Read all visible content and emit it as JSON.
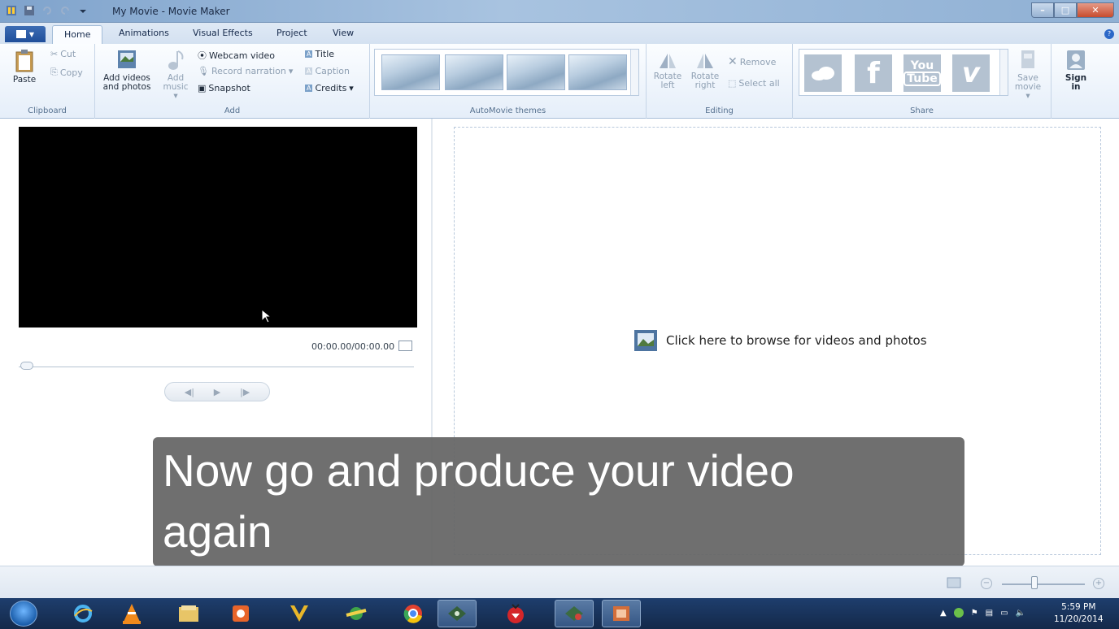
{
  "window": {
    "title": "My Movie - Movie Maker"
  },
  "tabs": [
    "Home",
    "Animations",
    "Visual Effects",
    "Project",
    "View"
  ],
  "ribbon": {
    "clipboard": {
      "paste": "Paste",
      "cut": "Cut",
      "copy": "Copy",
      "label": "Clipboard"
    },
    "add": {
      "add_videos_line1": "Add videos",
      "add_videos_line2": "and photos",
      "add_music_line1": "Add",
      "add_music_line2": "music",
      "webcam": "Webcam video",
      "record": "Record narration",
      "snapshot": "Snapshot",
      "title": "Title",
      "caption": "Caption",
      "credits": "Credits",
      "label": "Add"
    },
    "themes": {
      "label": "AutoMovie themes"
    },
    "editing": {
      "rotate_left_1": "Rotate",
      "rotate_left_2": "left",
      "rotate_right_1": "Rotate",
      "rotate_right_2": "right",
      "remove": "Remove",
      "select_all": "Select all",
      "label": "Editing"
    },
    "share": {
      "youtube_1": "You",
      "youtube_2": "Tube",
      "save_1": "Save",
      "save_2": "movie",
      "label": "Share"
    },
    "signin": {
      "line1": "Sign",
      "line2": "in"
    }
  },
  "preview": {
    "timecode": "00:00.00/00:00.00"
  },
  "storyboard": {
    "browse_text": "Click here to browse for videos and photos"
  },
  "caption_overlay": {
    "line1": "Now go and produce your video",
    "line2": "again"
  },
  "taskbar": {
    "time": "5:59 PM",
    "date": "11/20/2014"
  }
}
